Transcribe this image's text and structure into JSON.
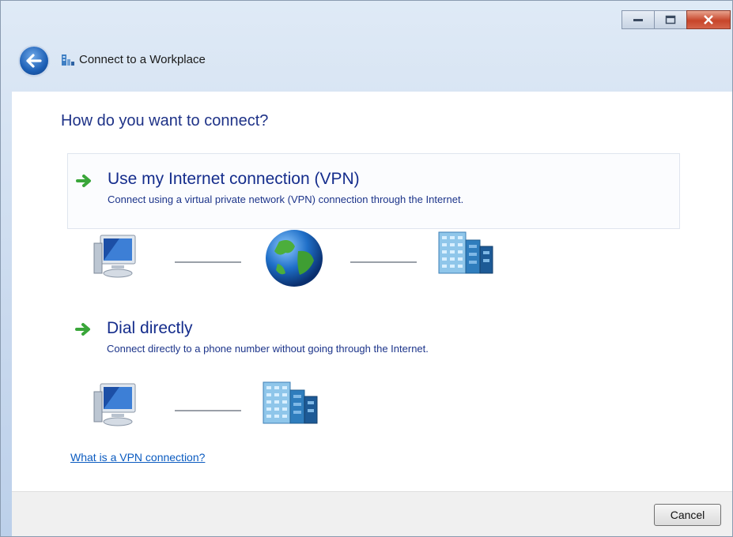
{
  "window": {
    "title": "Connect to a Workplace",
    "caption_buttons": [
      "minimize",
      "maximize",
      "close"
    ]
  },
  "main": {
    "heading": "How do you want to connect?",
    "options": [
      {
        "title": "Use my Internet connection (VPN)",
        "description": "Connect using a virtual private network (VPN) connection through the Internet.",
        "diagram": [
          "computer-icon",
          "globe-icon",
          "building-icon"
        ]
      },
      {
        "title": "Dial directly",
        "description": "Connect directly to a phone number without going through the Internet.",
        "diagram": [
          "computer-icon",
          "building-icon"
        ]
      }
    ],
    "help_link": "What is a VPN connection?"
  },
  "footer": {
    "cancel_label": "Cancel"
  },
  "colors": {
    "heading": "#1e3287",
    "link": "#0b5bc0",
    "arrow": "#3aa63a"
  }
}
